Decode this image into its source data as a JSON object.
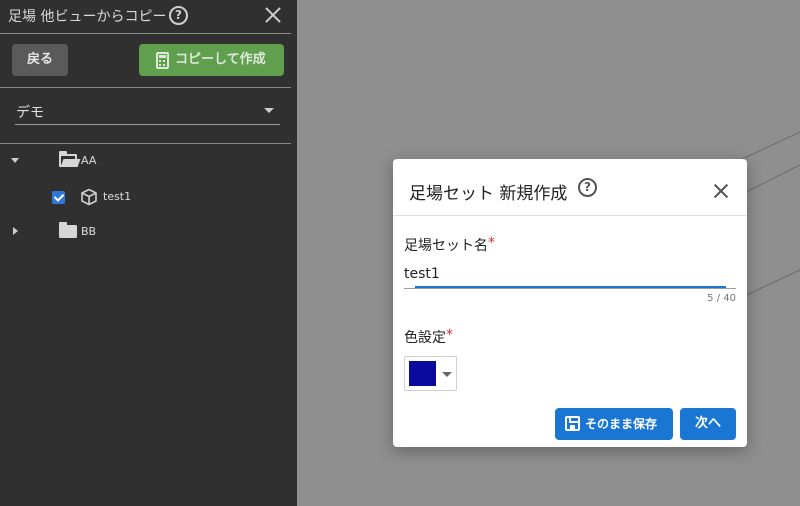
{
  "panel": {
    "title": "足場 他ビューからコピー",
    "help_icon": "help-circle-icon",
    "close_icon": "close-icon",
    "back_label": "戻る",
    "copy_label": "コピーして作成",
    "copy_icon": "calculator-icon",
    "select_value": "デモ",
    "tree": [
      {
        "label": "AA",
        "type": "folder-open",
        "expanded": true
      },
      {
        "label": "test1",
        "type": "model",
        "checked": true
      },
      {
        "label": "BB",
        "type": "folder",
        "expanded": false
      }
    ]
  },
  "dialog": {
    "title": "足場セット 新規作成",
    "help_icon": "help-circle-icon",
    "close_icon": "close-icon",
    "name_label": "足場セット名",
    "required_mark": "*",
    "name_value": "test1",
    "counter": "5 / 40",
    "color_label": "色設定",
    "color_value": "#0a0a9e",
    "save_label": "そのまま保存",
    "save_icon": "save-icon",
    "next_label": "次へ"
  },
  "colors": {
    "panel_bg": "#303030",
    "viewport_bg": "#8f8f8f",
    "primary": "#1976d2",
    "copy_button": "#5f9f4e",
    "required": "#d32f2f"
  }
}
